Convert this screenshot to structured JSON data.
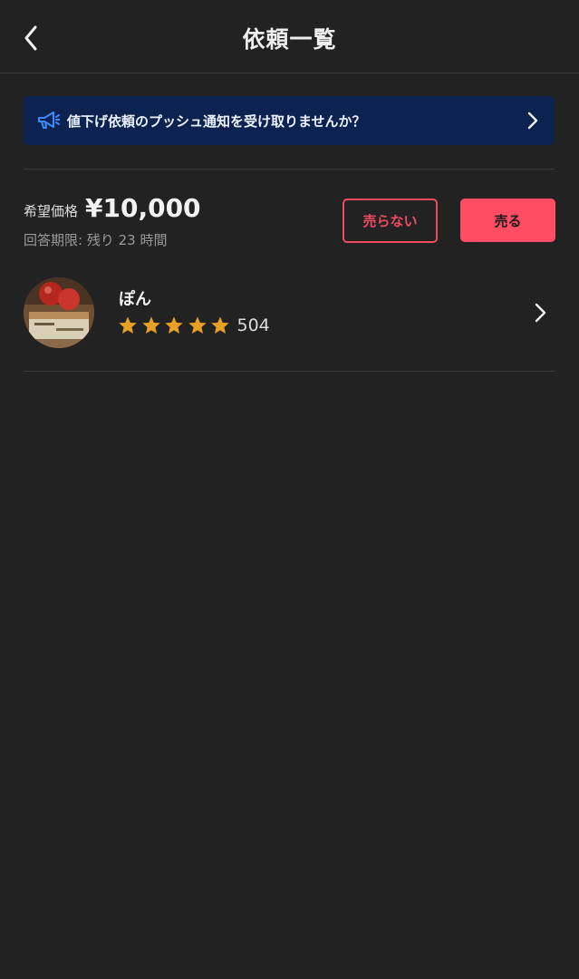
{
  "header": {
    "title": "依頼一覧",
    "back_icon": "chevron-left-icon"
  },
  "banner": {
    "icon": "megaphone-icon",
    "text": "値下げ依頼のプッシュ通知を受け取りませんか？",
    "background": "#0c2351"
  },
  "offer": {
    "price_label": "希望価格",
    "price": "¥10,000",
    "deadline": "回答期限: 残り 23 時間",
    "decline_label": "売らない",
    "sell_label": "売る",
    "accent_color": "#ff4d63"
  },
  "buyer": {
    "name": "ぽん",
    "rating_stars": 5,
    "review_count": "504",
    "star_color": "#e6a024"
  }
}
